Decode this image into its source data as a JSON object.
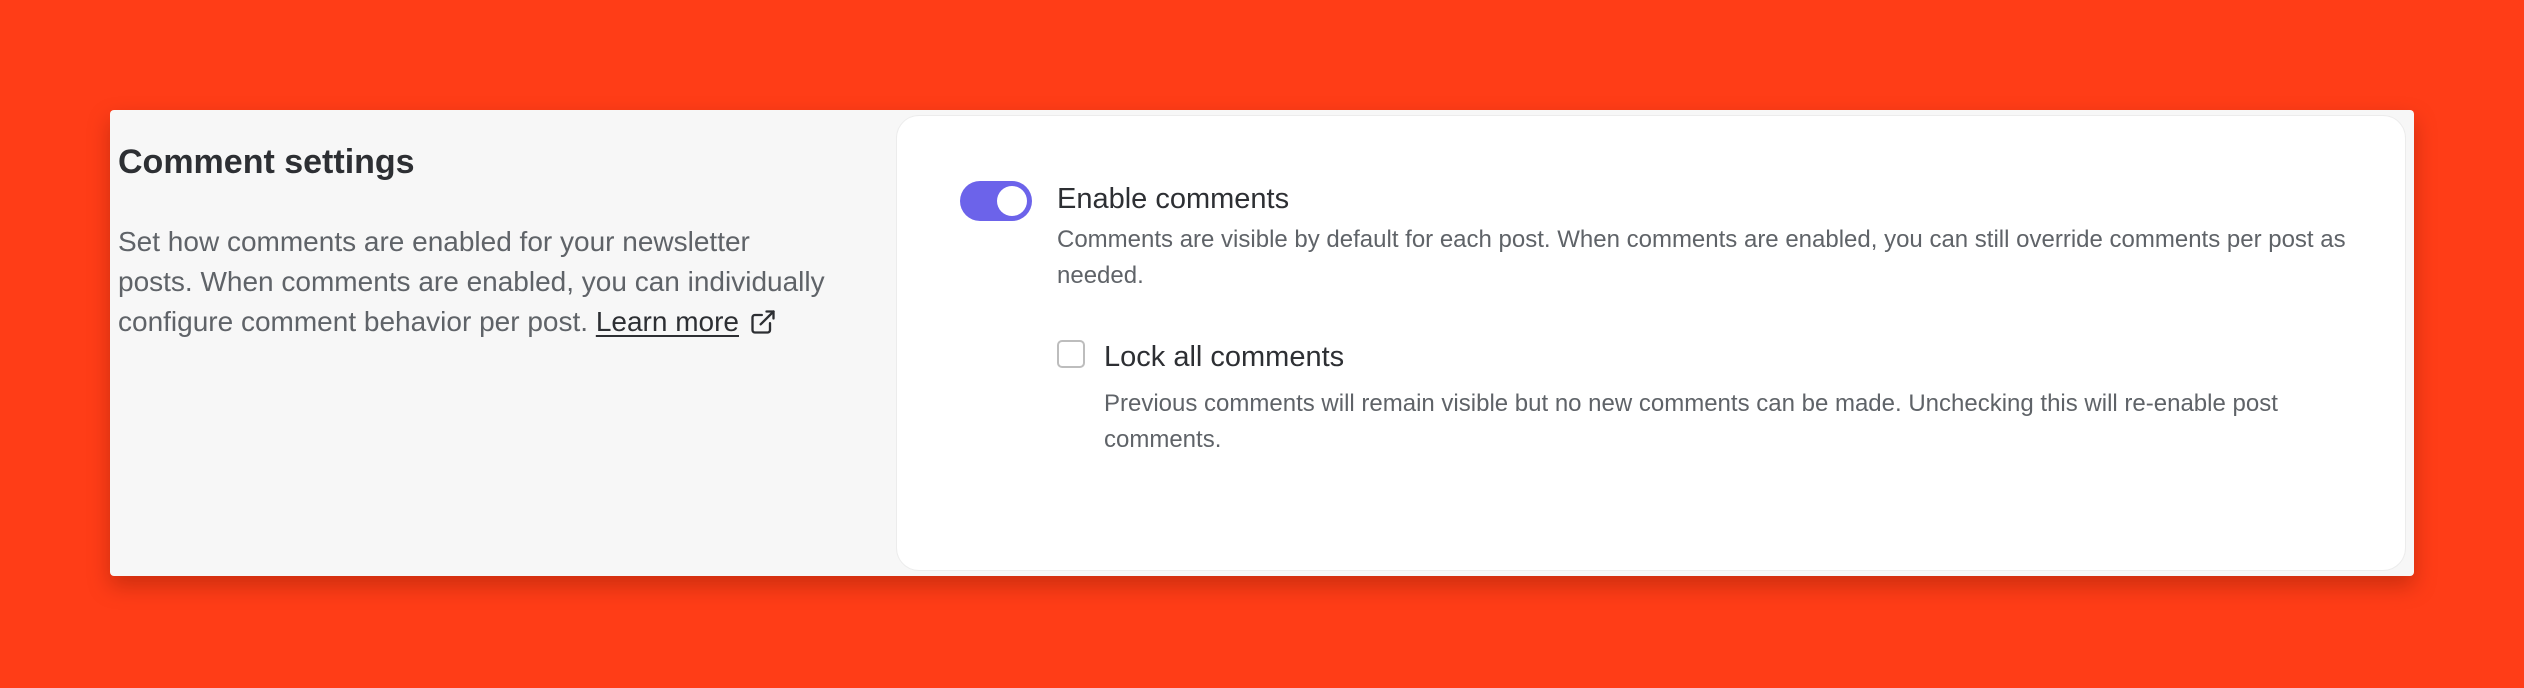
{
  "section": {
    "title": "Comment settings",
    "description": "Set how comments are enabled for your newsletter posts. When comments are enabled, you can individually configure comment behavior per post.",
    "learn_more_label": "Learn more",
    "learn_more_icon": "external-link-icon"
  },
  "settings": {
    "enable_comments": {
      "label": "Enable comments",
      "help": "Comments are visible by default for each post. When comments are enabled, you can still override comments per post as needed.",
      "enabled": true
    },
    "lock_all_comments": {
      "label": "Lock all comments",
      "help": "Previous comments will remain visible but no new comments can be made. Unchecking this will re-enable post comments.",
      "checked": false
    }
  },
  "colors": {
    "background": "#ff3d17",
    "toggle_on": "#6c63ea",
    "panel": "#f7f7f7",
    "card": "#ffffff"
  }
}
